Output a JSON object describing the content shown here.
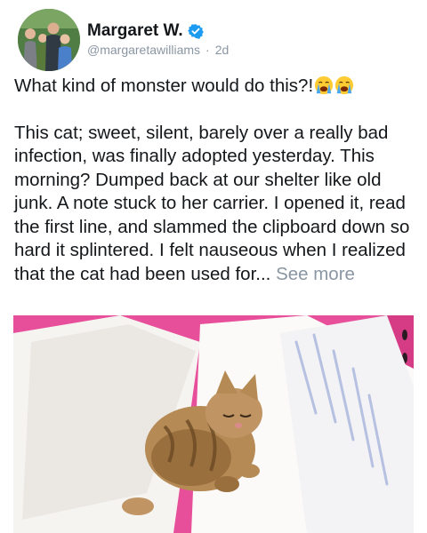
{
  "author": {
    "name": "Margaret W.",
    "handle": "@margaretawilliams",
    "separator": "·",
    "time": "2d",
    "avatar_icon": "family-photo-avatar",
    "verified_icon": "verified-badge-icon",
    "verified_color": "#1d9bf0"
  },
  "post": {
    "headline": "What kind of monster would do this?!",
    "headline_emoji": [
      "crying-face-emoji",
      "crying-face-emoji"
    ],
    "body": "This cat; sweet, silent, barely over a really bad infection, was finally adopted yesterday. This morning? Dumped back at our shelter like old junk. A note stuck to her carrier. I opened it, read the first line, and slammed the clipboard down so hard it splintered. I felt nauseous when I realized that the cat had been used for...",
    "see_more": "See more"
  },
  "photo": {
    "subject": "tabby kitten lying on white paper inside a pink carrier",
    "background_color": "#e84f9a"
  }
}
